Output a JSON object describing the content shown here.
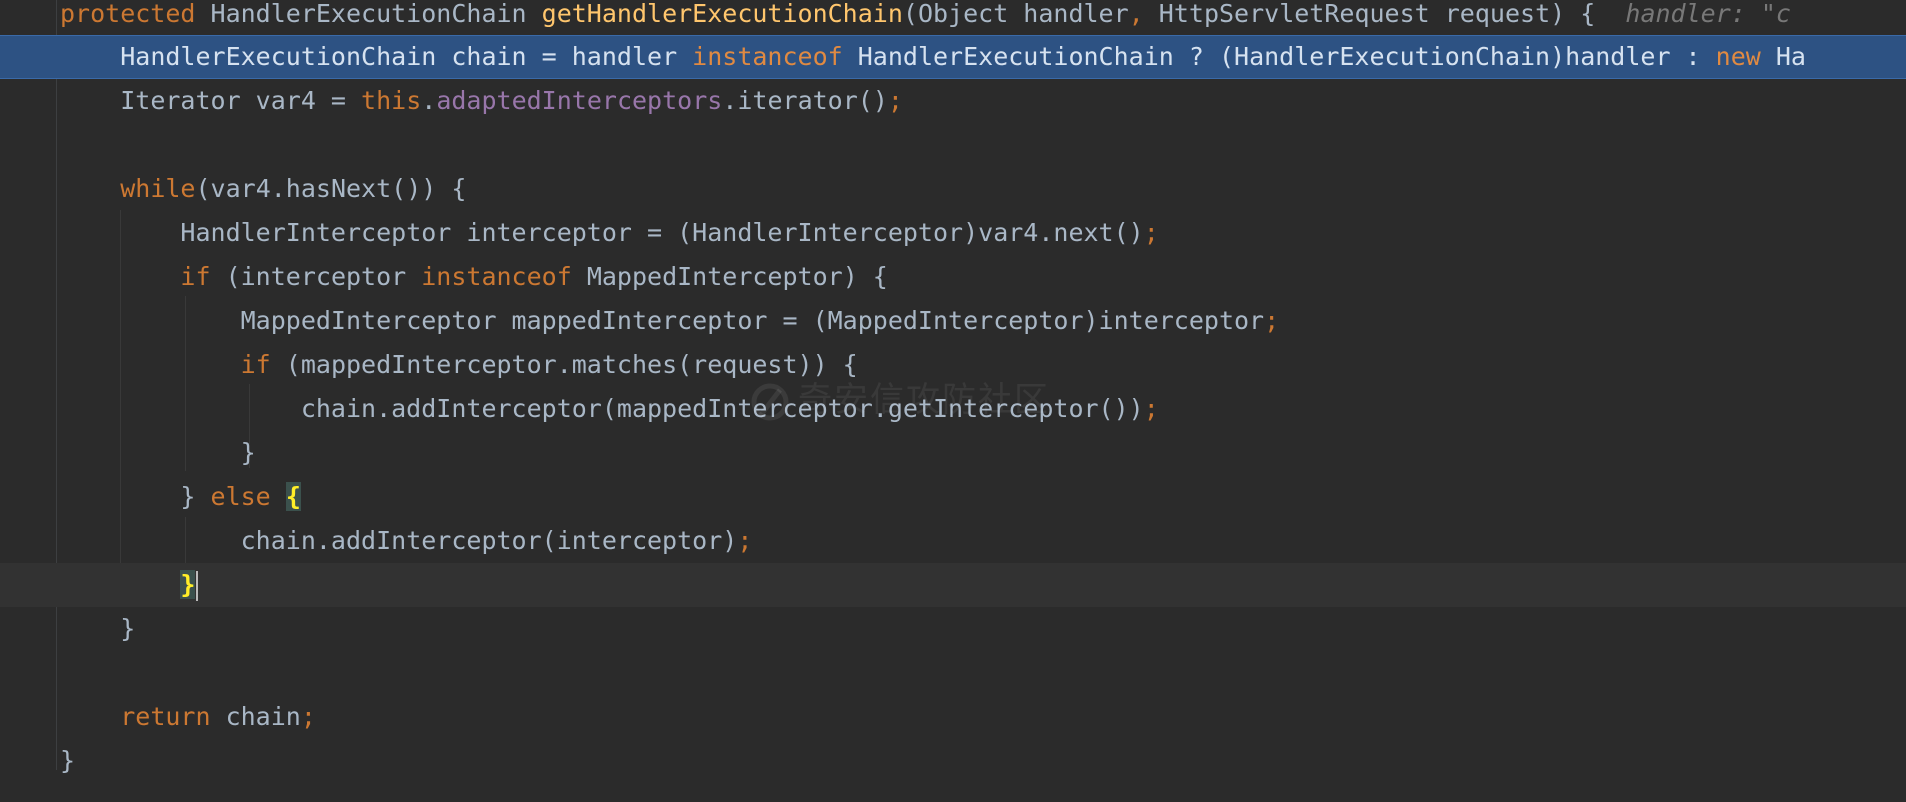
{
  "editor": {
    "signature": {
      "protected": "protected",
      "return_type": " HandlerExecutionChain ",
      "method_name": "getHandlerExecutionChain",
      "params_open": "(Object handler",
      "comma": ",",
      "params_rest": " HttpServletRequest request) {",
      "inline_hint": "handler: \"c"
    },
    "line_chain": {
      "indent": "    ",
      "part1": "HandlerExecutionChain chain = handler ",
      "instanceof": "instanceof",
      "part2": " HandlerExecutionChain ? (HandlerExecutionChain)handler : ",
      "new": "new",
      "part3": " Ha"
    },
    "line_iterator": {
      "indent": "    ",
      "part1": "Iterator var4 = ",
      "this": "this",
      "dot": ".",
      "field": "adaptedInterceptors",
      "part2": ".iterator()",
      "semi": ";"
    },
    "line_while": {
      "indent": "    ",
      "kw": "while",
      "rest": "(var4.hasNext()) {"
    },
    "line_next": {
      "indent": "        ",
      "text": "HandlerInterceptor interceptor = (HandlerInterceptor)var4.next()",
      "semi": ";"
    },
    "line_if1": {
      "indent": "        ",
      "kw": "if",
      "part1": " (interceptor ",
      "instanceof": "instanceof",
      "part2": " MappedInterceptor) {"
    },
    "line_mapped": {
      "indent": "            ",
      "text": "MappedInterceptor mappedInterceptor = (MappedInterceptor)interceptor",
      "semi": ";"
    },
    "line_if2": {
      "indent": "            ",
      "kw": "if",
      "rest": " (mappedInterceptor.matches(request)) {"
    },
    "line_add1": {
      "indent": "                ",
      "text": "chain.addInterceptor(mappedInterceptor.getInterceptor())",
      "semi": ";"
    },
    "line_close_if2": {
      "indent": "            ",
      "text": "}"
    },
    "line_else": {
      "indent": "        ",
      "close": "} ",
      "kw": "else",
      "space": " ",
      "brace": "{"
    },
    "line_add2": {
      "indent": "            ",
      "text": "chain.addInterceptor(interceptor)",
      "semi": ";"
    },
    "line_close_else": {
      "indent": "        ",
      "brace": "}"
    },
    "line_close_while": {
      "indent": "    ",
      "text": "}"
    },
    "line_return": {
      "indent": "    ",
      "kw": "return",
      "rest": " chain",
      "semi": ";"
    },
    "line_close_method": {
      "indent": "",
      "text": "}"
    }
  },
  "watermark": {
    "text": "奇安信攻防社区"
  },
  "colors": {
    "background": "#2b2b2b",
    "keyword": "#cc7832",
    "method": "#ffc66d",
    "field": "#9876aa",
    "text": "#a9b7c6",
    "exec_line": "#2d5283"
  }
}
